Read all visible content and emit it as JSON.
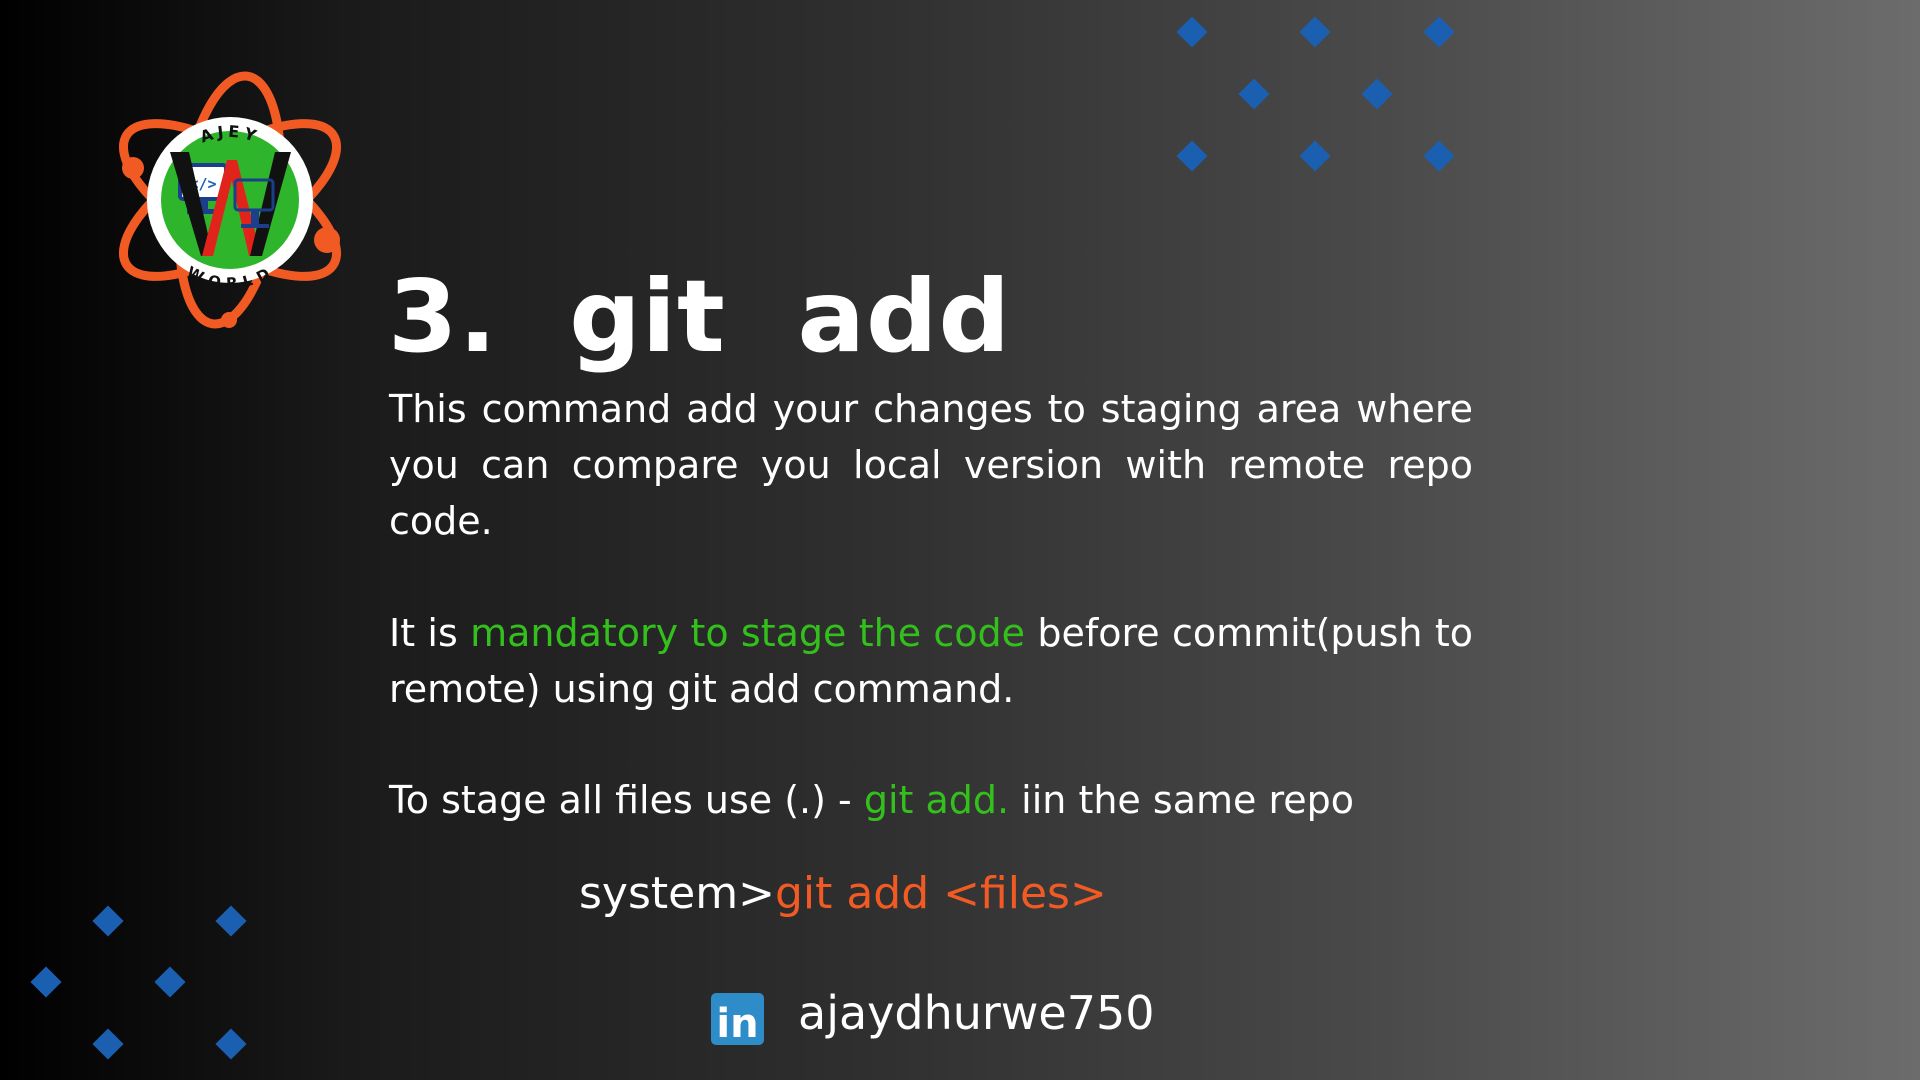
{
  "slide": {
    "title": "3.  git  add",
    "paragraph1": "This command add your changes to staging area where you can compare you local version with remote repo code.",
    "paragraph2": {
      "prefix": "It is ",
      "highlight": "mandatory to stage the code",
      "suffix": " before commit(push to remote) using git add command."
    },
    "paragraph3": {
      "prefix": "To stage all files use (.) - ",
      "highlight": "git add.",
      "suffix": " iin the same repo"
    },
    "command": {
      "prompt": "system>",
      "text": "git add <files>"
    },
    "footer": {
      "icon": "linkedin-icon",
      "icon_text": "in",
      "handle": "ajaydhurwe750"
    }
  },
  "logo": {
    "top_text": "AJEY",
    "bottom_text": "WORLD",
    "code_glyph": "</>"
  },
  "colors": {
    "highlight_green": "#33c01c",
    "command_orange": "#f25a24",
    "diamond_blue": "#1b5fb0",
    "linkedin_blue": "#2e8cc9",
    "logo_orange": "#f25a24",
    "logo_green": "#2fb52b"
  }
}
